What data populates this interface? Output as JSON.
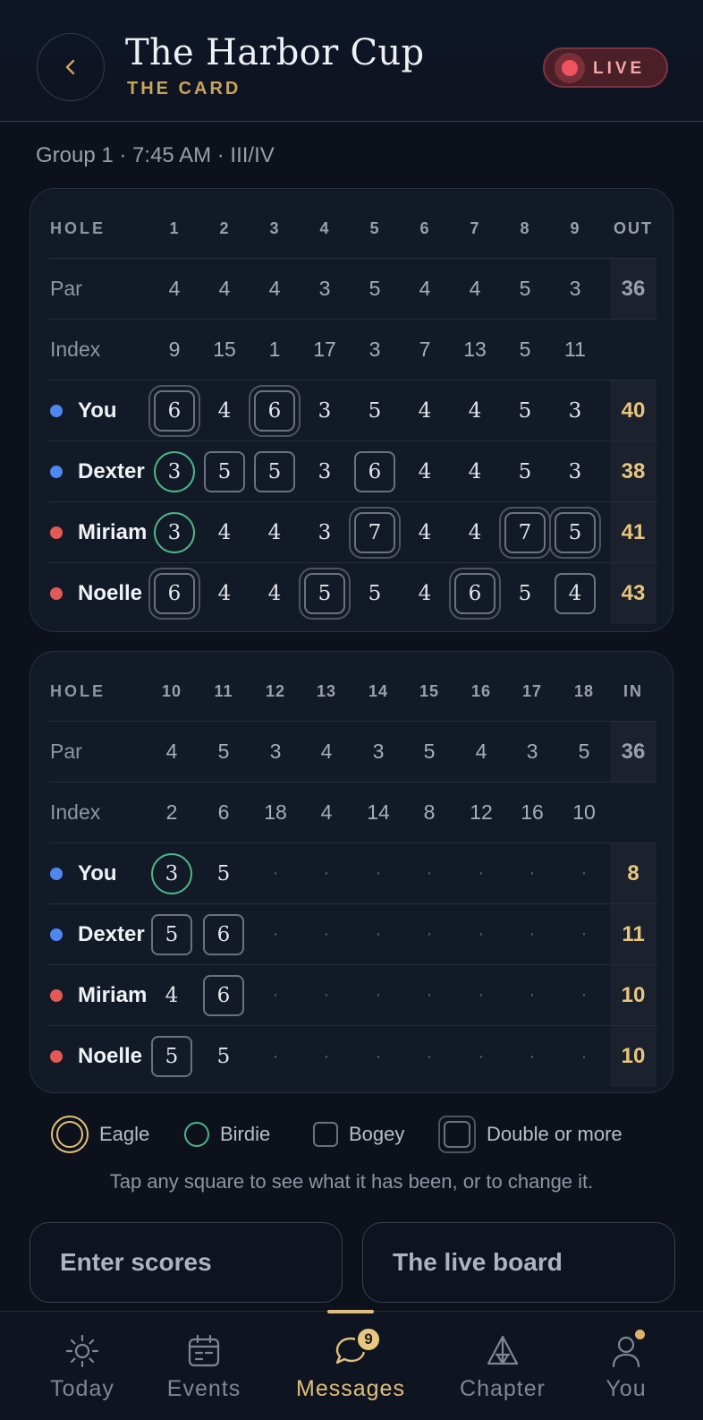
{
  "header": {
    "title": "The Harbor Cup",
    "subtitle": "THE CARD",
    "live_label": "LIVE",
    "back_icon": "chevron-left-icon"
  },
  "group_info": "Group 1 · 7:45 AM · III/IV",
  "colors": {
    "accent": "#c9a45c",
    "birdie": "#4eb586",
    "eagle": "#e2bf7a",
    "blue_team": "#4f87f0",
    "red_team": "#e25a55",
    "live": "#f0525f"
  },
  "front_nine": {
    "head_label": "HOLE",
    "holes": [
      "1",
      "2",
      "3",
      "4",
      "5",
      "6",
      "7",
      "8",
      "9"
    ],
    "total_label": "OUT",
    "par_label": "Par",
    "par": [
      "4",
      "4",
      "4",
      "3",
      "5",
      "4",
      "4",
      "5",
      "3"
    ],
    "par_total": "36",
    "index_label": "Index",
    "index": [
      "9",
      "15",
      "1",
      "17",
      "3",
      "7",
      "13",
      "5",
      "11"
    ],
    "players": [
      {
        "name": "You",
        "team": "blue",
        "total": "40",
        "scores": [
          "6",
          "4",
          "6",
          "3",
          "5",
          "4",
          "4",
          "5",
          "3"
        ],
        "marks": [
          "double",
          "",
          "double",
          "",
          "",
          "",
          "",
          "",
          ""
        ]
      },
      {
        "name": "Dexter",
        "team": "blue",
        "total": "38",
        "scores": [
          "3",
          "5",
          "5",
          "3",
          "6",
          "4",
          "4",
          "5",
          "3"
        ],
        "marks": [
          "birdie",
          "bogey",
          "bogey",
          "",
          "bogey",
          "",
          "",
          "",
          ""
        ]
      },
      {
        "name": "Miriam",
        "team": "red",
        "total": "41",
        "scores": [
          "3",
          "4",
          "4",
          "3",
          "7",
          "4",
          "4",
          "7",
          "5"
        ],
        "marks": [
          "birdie",
          "",
          "",
          "",
          "double",
          "",
          "",
          "double",
          "double"
        ]
      },
      {
        "name": "Noelle",
        "team": "red",
        "total": "43",
        "scores": [
          "6",
          "4",
          "4",
          "5",
          "5",
          "4",
          "6",
          "5",
          "4"
        ],
        "marks": [
          "double",
          "",
          "",
          "double",
          "",
          "",
          "double",
          "",
          "bogey"
        ]
      }
    ]
  },
  "back_nine": {
    "head_label": "HOLE",
    "holes": [
      "10",
      "11",
      "12",
      "13",
      "14",
      "15",
      "16",
      "17",
      "18"
    ],
    "total_label": "IN",
    "par_label": "Par",
    "par": [
      "4",
      "5",
      "3",
      "4",
      "3",
      "5",
      "4",
      "3",
      "5"
    ],
    "par_total": "36",
    "index_label": "Index",
    "index": [
      "2",
      "6",
      "18",
      "4",
      "14",
      "8",
      "12",
      "16",
      "10"
    ],
    "players": [
      {
        "name": "You",
        "team": "blue",
        "total": "8",
        "scores": [
          "3",
          "5",
          "·",
          "·",
          "·",
          "·",
          "·",
          "·",
          "·"
        ],
        "marks": [
          "birdie",
          "",
          "",
          "",
          "",
          "",
          "",
          "",
          ""
        ]
      },
      {
        "name": "Dexter",
        "team": "blue",
        "total": "11",
        "scores": [
          "5",
          "6",
          "·",
          "·",
          "·",
          "·",
          "·",
          "·",
          "·"
        ],
        "marks": [
          "bogey",
          "bogey",
          "",
          "",
          "",
          "",
          "",
          "",
          ""
        ]
      },
      {
        "name": "Miriam",
        "team": "red",
        "total": "10",
        "scores": [
          "4",
          "6",
          "·",
          "·",
          "·",
          "·",
          "·",
          "·",
          "·"
        ],
        "marks": [
          "",
          "bogey",
          "",
          "",
          "",
          "",
          "",
          "",
          ""
        ]
      },
      {
        "name": "Noelle",
        "team": "red",
        "total": "10",
        "scores": [
          "5",
          "5",
          "·",
          "·",
          "·",
          "·",
          "·",
          "·",
          "·"
        ],
        "marks": [
          "bogey",
          "",
          "",
          "",
          "",
          "",
          "",
          "",
          ""
        ]
      }
    ]
  },
  "legend": {
    "eagle": "Eagle",
    "birdie": "Birdie",
    "bogey": "Bogey",
    "double": "Double or more"
  },
  "hint": "Tap any square to see what it has been, or to change it.",
  "actions": {
    "enter_scores": "Enter scores",
    "live_board": "The live board"
  },
  "tabs": [
    {
      "label": "Today",
      "icon": "sun-icon"
    },
    {
      "label": "Events",
      "icon": "calendar-icon"
    },
    {
      "label": "Messages",
      "icon": "chat-bubble-icon",
      "badge": "9",
      "active": true
    },
    {
      "label": "Chapter",
      "icon": "tent-icon"
    },
    {
      "label": "You",
      "icon": "person-icon"
    }
  ]
}
